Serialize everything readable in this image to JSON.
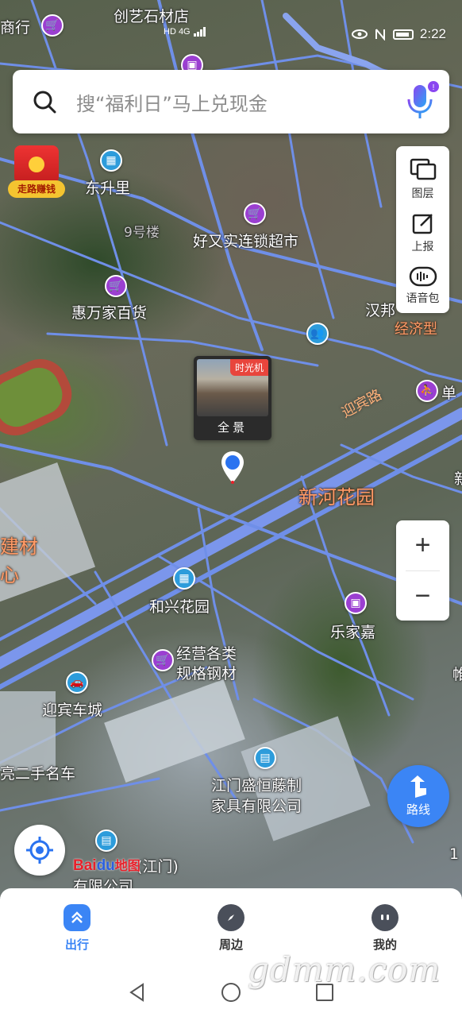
{
  "status_bar": {
    "time": "2:22",
    "network_left": "HD 4G"
  },
  "search": {
    "placeholder": "搜“福利日”马上兑现金"
  },
  "reward": {
    "label": "走路赚钱"
  },
  "side_panel": {
    "items": [
      {
        "label": "图层",
        "icon": "layers-icon"
      },
      {
        "label": "上报",
        "icon": "report-edit-icon"
      },
      {
        "label": "语音包",
        "icon": "voice-pack-icon"
      }
    ]
  },
  "zoom": {
    "in": "+",
    "out": "−"
  },
  "pano": {
    "badge": "时光机",
    "label": "全景"
  },
  "map_labels": {
    "top_left_store": "商行",
    "stone_store": "创艺石材店",
    "dongshengli": "东升里",
    "building9": "9号楼",
    "haoyoushi": "好又实连锁超市",
    "huiwanjia": "惠万家百货",
    "hanbang": "汉邦",
    "jingjixing": "经济型",
    "yingbinlu": "迎宾路",
    "dan": "单",
    "xinhe": "新河花园",
    "jiancai": "建材",
    "xin": "心",
    "hexing": "和兴花园",
    "lejia": "乐家嘉",
    "steel": "经营各类",
    "steel2": "规格钢材",
    "car_city": "迎宾车城",
    "used_car": "亮二手名车",
    "rattan1": "江门盛恒藤制",
    "rattan2": "家具有限公司",
    "bottom_company": "有限公司",
    "bottom_zhi": "(江门)",
    "right_edge1": "新",
    "right_edge2": "帷",
    "right_edge3": "1"
  },
  "brand": {
    "bai": "Bai",
    "paw": "du",
    "cn": "地图"
  },
  "route": {
    "label": "路线"
  },
  "tabs": [
    {
      "label": "出行",
      "active": true
    },
    {
      "label": "周边",
      "active": false
    },
    {
      "label": "我的",
      "active": false
    }
  ],
  "watermark": "gdmm.com",
  "colors": {
    "accent": "#3b85f5",
    "road": "#6f8fe8",
    "poi_purple": "#9b3fd1",
    "area_orange": "#ff9a66"
  }
}
